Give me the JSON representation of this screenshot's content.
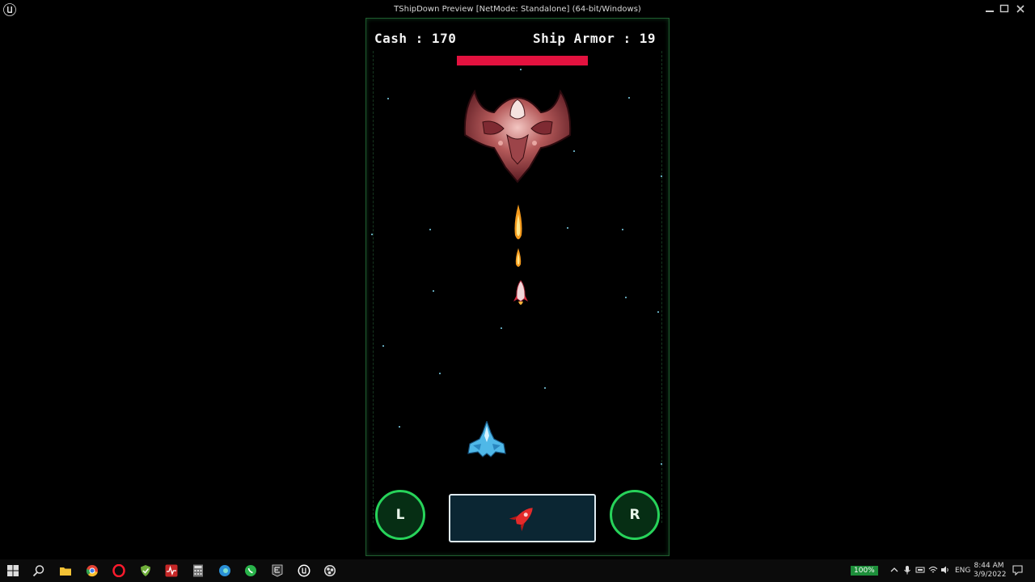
{
  "window": {
    "title": "TShipDown Preview [NetMode: Standalone]  (64-bit/Windows)",
    "min_icon": "minimize-icon",
    "max_icon": "maximize-icon",
    "close_icon": "close-icon"
  },
  "hud": {
    "cash_text": "Cash : 170",
    "armor_text": "Ship Armor : 19",
    "boss_health_fraction": 1.0,
    "boss_health_color": "#e3123f"
  },
  "controls": {
    "left_label": "L",
    "right_label": "R",
    "fire_icon": "rocket-icon",
    "button_color": "#27d35a"
  },
  "taskbar": {
    "icons": [
      "windows-start-icon",
      "search-icon",
      "file-explorer-icon",
      "chrome-icon",
      "opera-icon",
      "vpn-shield-icon",
      "activity-monitor-icon",
      "calculator-icon",
      "edge-icon",
      "whatsapp-icon",
      "epic-games-icon",
      "unreal-engine-icon",
      "obs-icon"
    ],
    "zoom": "100%",
    "language": "ENG",
    "time": "8:44 AM",
    "date": "3/9/2022"
  }
}
